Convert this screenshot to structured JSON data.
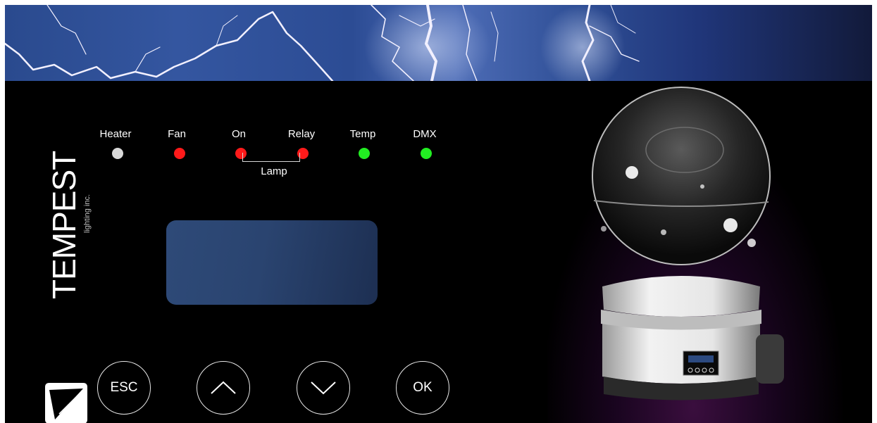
{
  "leds": [
    {
      "label": "Heater",
      "color": "#d9d9d9"
    },
    {
      "label": "Fan",
      "color": "#ff1a1a"
    },
    {
      "label": "On",
      "color": "#ff1a1a"
    },
    {
      "label": "Relay",
      "color": "#ff1a1a"
    },
    {
      "label": "Temp",
      "color": "#22ee22"
    },
    {
      "label": "DMX",
      "color": "#22ee22"
    }
  ],
  "lamp_group_label": "Lamp",
  "brand": {
    "name": "TEMPEST",
    "subtitle": "lighting inc."
  },
  "display": {
    "text": ""
  },
  "buttons": {
    "esc": "ESC",
    "ok": "OK",
    "up_icon": "chevron-up-icon",
    "down_icon": "chevron-down-icon"
  }
}
